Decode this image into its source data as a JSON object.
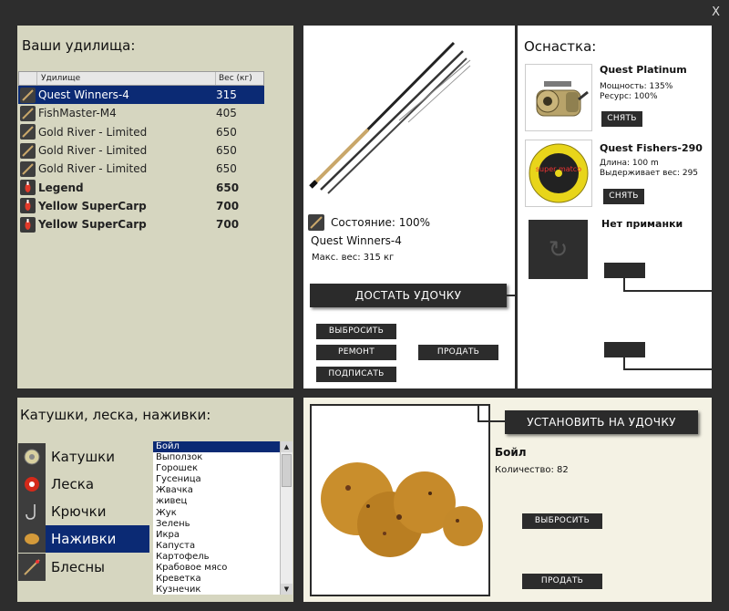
{
  "window": {
    "close_label": "X"
  },
  "rods_panel": {
    "title": "Ваши удилища:",
    "columns": [
      "Удилище",
      "Вес (кг)"
    ],
    "rows": [
      {
        "name": "Quest Winners-4",
        "weight": "315",
        "icon": "rod-icon",
        "selected": true,
        "bold": false
      },
      {
        "name": "FishMaster-M4",
        "weight": "405",
        "icon": "rod-icon",
        "selected": false,
        "bold": false
      },
      {
        "name": "Gold River - Limited",
        "weight": "650",
        "icon": "rod-icon",
        "selected": false,
        "bold": false
      },
      {
        "name": "Gold River - Limited",
        "weight": "650",
        "icon": "rod-icon",
        "selected": false,
        "bold": false
      },
      {
        "name": "Gold River - Limited",
        "weight": "650",
        "icon": "rod-icon",
        "selected": false,
        "bold": false
      },
      {
        "name": "Legend",
        "weight": "650",
        "icon": "float-icon",
        "selected": false,
        "bold": true
      },
      {
        "name": "Yellow SuperCarp",
        "weight": "700",
        "icon": "float-icon",
        "selected": false,
        "bold": true
      },
      {
        "name": "Yellow SuperCarp",
        "weight": "700",
        "icon": "float-icon",
        "selected": false,
        "bold": true
      }
    ]
  },
  "rod_detail": {
    "condition": "Состояние: 100%",
    "name": "Quest Winners-4",
    "max_weight": "Макс. вес: 315 кг",
    "take_button": "ДОСТАТЬ УДОЧКУ",
    "discard_button": "ВЫБРОСИТЬ",
    "repair_button": "РЕМОНТ",
    "sign_button": "ПОДПИСАТЬ",
    "sell_button": "ПРОДАТЬ"
  },
  "tackle": {
    "title": "Оснастка:",
    "reel": {
      "name": "Quest Platinum",
      "power": "Мощность: 135%",
      "resource": "Ресурс: 100%",
      "remove_button": "СНЯТЬ"
    },
    "line": {
      "name": "Quest Fishers-290",
      "length": "Длина: 100 m",
      "holds": "Выдерживает вес: 295",
      "remove_button": "СНЯТЬ",
      "spool_text": "super matco"
    },
    "bait": {
      "name": "Нет приманки"
    }
  },
  "inventory": {
    "title": "Катушки, леска, наживки:",
    "categories": [
      {
        "label": "Катушки",
        "icon": "reel-icon",
        "selected": false
      },
      {
        "label": "Леска",
        "icon": "line-spool-icon",
        "selected": false
      },
      {
        "label": "Крючки",
        "icon": "hook-icon",
        "selected": false
      },
      {
        "label": "Наживки",
        "icon": "bait-icon",
        "selected": true
      },
      {
        "label": "Блесны",
        "icon": "lure-icon",
        "selected": false
      }
    ],
    "items": [
      "Бойл",
      "Выползок",
      "Горошек",
      "Гусеница",
      "Жвачка",
      "живец",
      "Жук",
      "Зелень",
      "Икра",
      "Капуста",
      "Картофель",
      "Крабовое мясо",
      "Креветка",
      "Кузнечик"
    ],
    "selected_index": 0
  },
  "bait_detail": {
    "install_button": "УСТАНОВИТЬ НА УДОЧКУ",
    "name": "Бойл",
    "quantity": "Количество: 82",
    "discard_button": "ВЫБРОСИТЬ",
    "sell_button": "ПРОДАТЬ"
  },
  "colors": {
    "selection": "#0b2a74",
    "panel": "#d6d6c0",
    "frame": "#2d2d2d",
    "button": "#2c2c2c"
  }
}
